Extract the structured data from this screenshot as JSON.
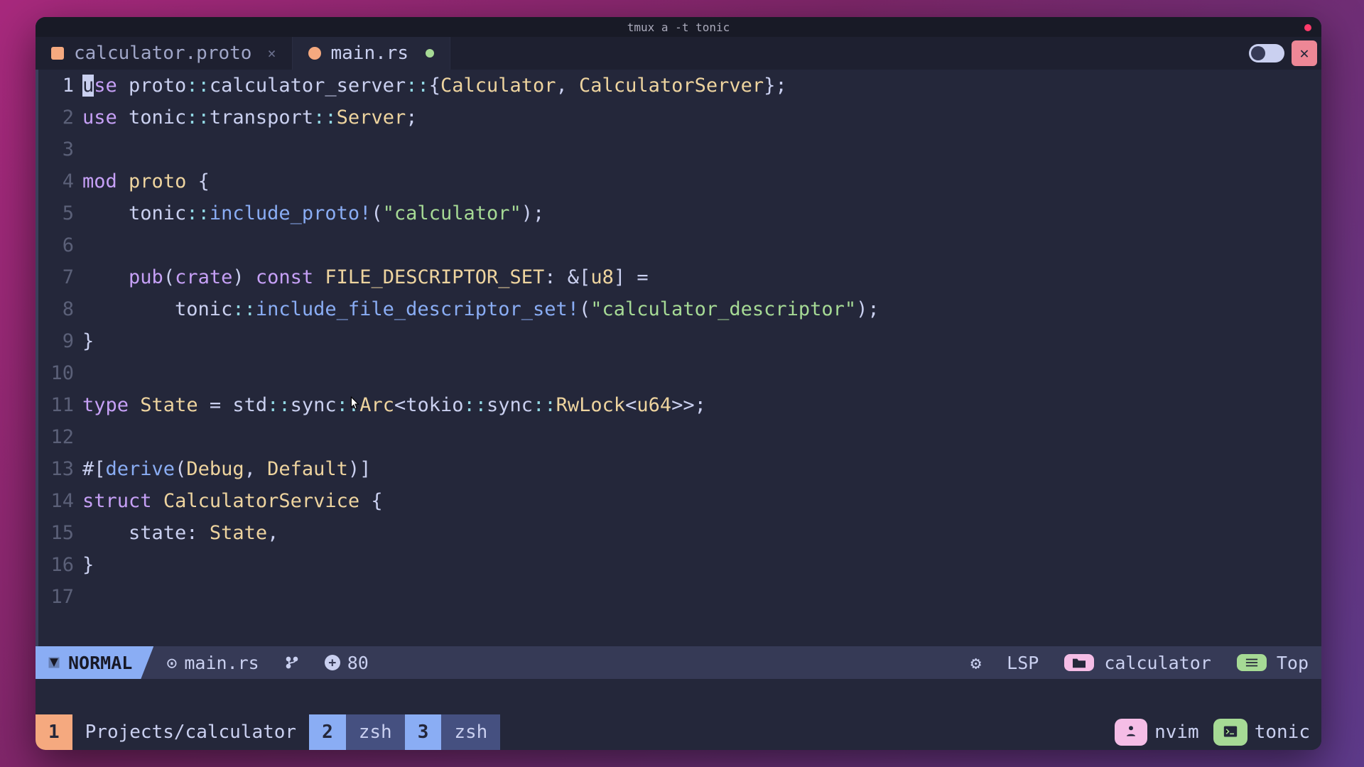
{
  "window_title": "tmux a -t tonic",
  "tabs": [
    {
      "name": "calculator.proto",
      "active": false,
      "modified": false
    },
    {
      "name": "main.rs",
      "active": true,
      "modified": true
    }
  ],
  "code_lines": [
    {
      "n": 1,
      "html": "<span class='kw'><span class='cursor'>u</span>se</span> proto<span class='pun'>::</span>calculator_server<span class='pun'>::</span>{<span class='ty'>Calculator</span>, <span class='ty'>CalculatorServer</span>};"
    },
    {
      "n": 2,
      "html": "<span class='kw'>use</span> tonic<span class='pun'>::</span>transport<span class='pun'>::</span><span class='ty'>Server</span>;"
    },
    {
      "n": 3,
      "html": ""
    },
    {
      "n": 4,
      "html": "<span class='kw'>mod</span> <span class='ty'>proto</span> {"
    },
    {
      "n": 5,
      "html": "    tonic<span class='pun'>::</span><span class='mac'>include_proto!</span>(<span class='str'>\"calculator\"</span>);"
    },
    {
      "n": 6,
      "html": ""
    },
    {
      "n": 7,
      "html": "    <span class='kw'>pub</span>(<span class='kw'>crate</span>) <span class='kw'>const</span> <span class='ty'>FILE_DESCRIPTOR_SET</span>: &[<span class='ty'>u8</span>] ="
    },
    {
      "n": 8,
      "html": "        tonic<span class='pun'>::</span><span class='mac'>include_file_descriptor_set!</span>(<span class='str'>\"calculator_descriptor\"</span>);"
    },
    {
      "n": 9,
      "html": "}"
    },
    {
      "n": 10,
      "html": ""
    },
    {
      "n": 11,
      "html": "<span class='kw'>type</span> <span class='ty'>State</span> = std<span class='pun'>::</span>sync<span class='pun'>::</span><span class='ty'>Arc</span>&lt;tokio<span class='pun'>::</span>sync<span class='pun'>::</span><span class='ty'>RwLock</span>&lt;<span class='ty'>u64</span>&gt;&gt;;"
    },
    {
      "n": 12,
      "html": ""
    },
    {
      "n": 13,
      "html": "#[<span class='fn'>derive</span>(<span class='ty'>Debug</span>, <span class='ty'>Default</span>)]"
    },
    {
      "n": 14,
      "html": "<span class='kw'>struct</span> <span class='ty'>CalculatorService</span> {"
    },
    {
      "n": 15,
      "html": "    state: <span class='ty'>State</span>,"
    },
    {
      "n": 16,
      "html": "}"
    },
    {
      "n": 17,
      "html": ""
    }
  ],
  "statusline": {
    "mode": "NORMAL",
    "filename": "main.rs",
    "changes": "80",
    "lsp": "LSP",
    "project": "calculator",
    "position": "Top"
  },
  "tmux": {
    "windows": [
      {
        "index": "1",
        "name": "Projects/calculator",
        "active": true
      },
      {
        "index": "2",
        "name": "zsh",
        "active": false
      },
      {
        "index": "3",
        "name": "zsh",
        "active": false
      }
    ],
    "right": {
      "app": "nvim",
      "session": "tonic"
    }
  }
}
